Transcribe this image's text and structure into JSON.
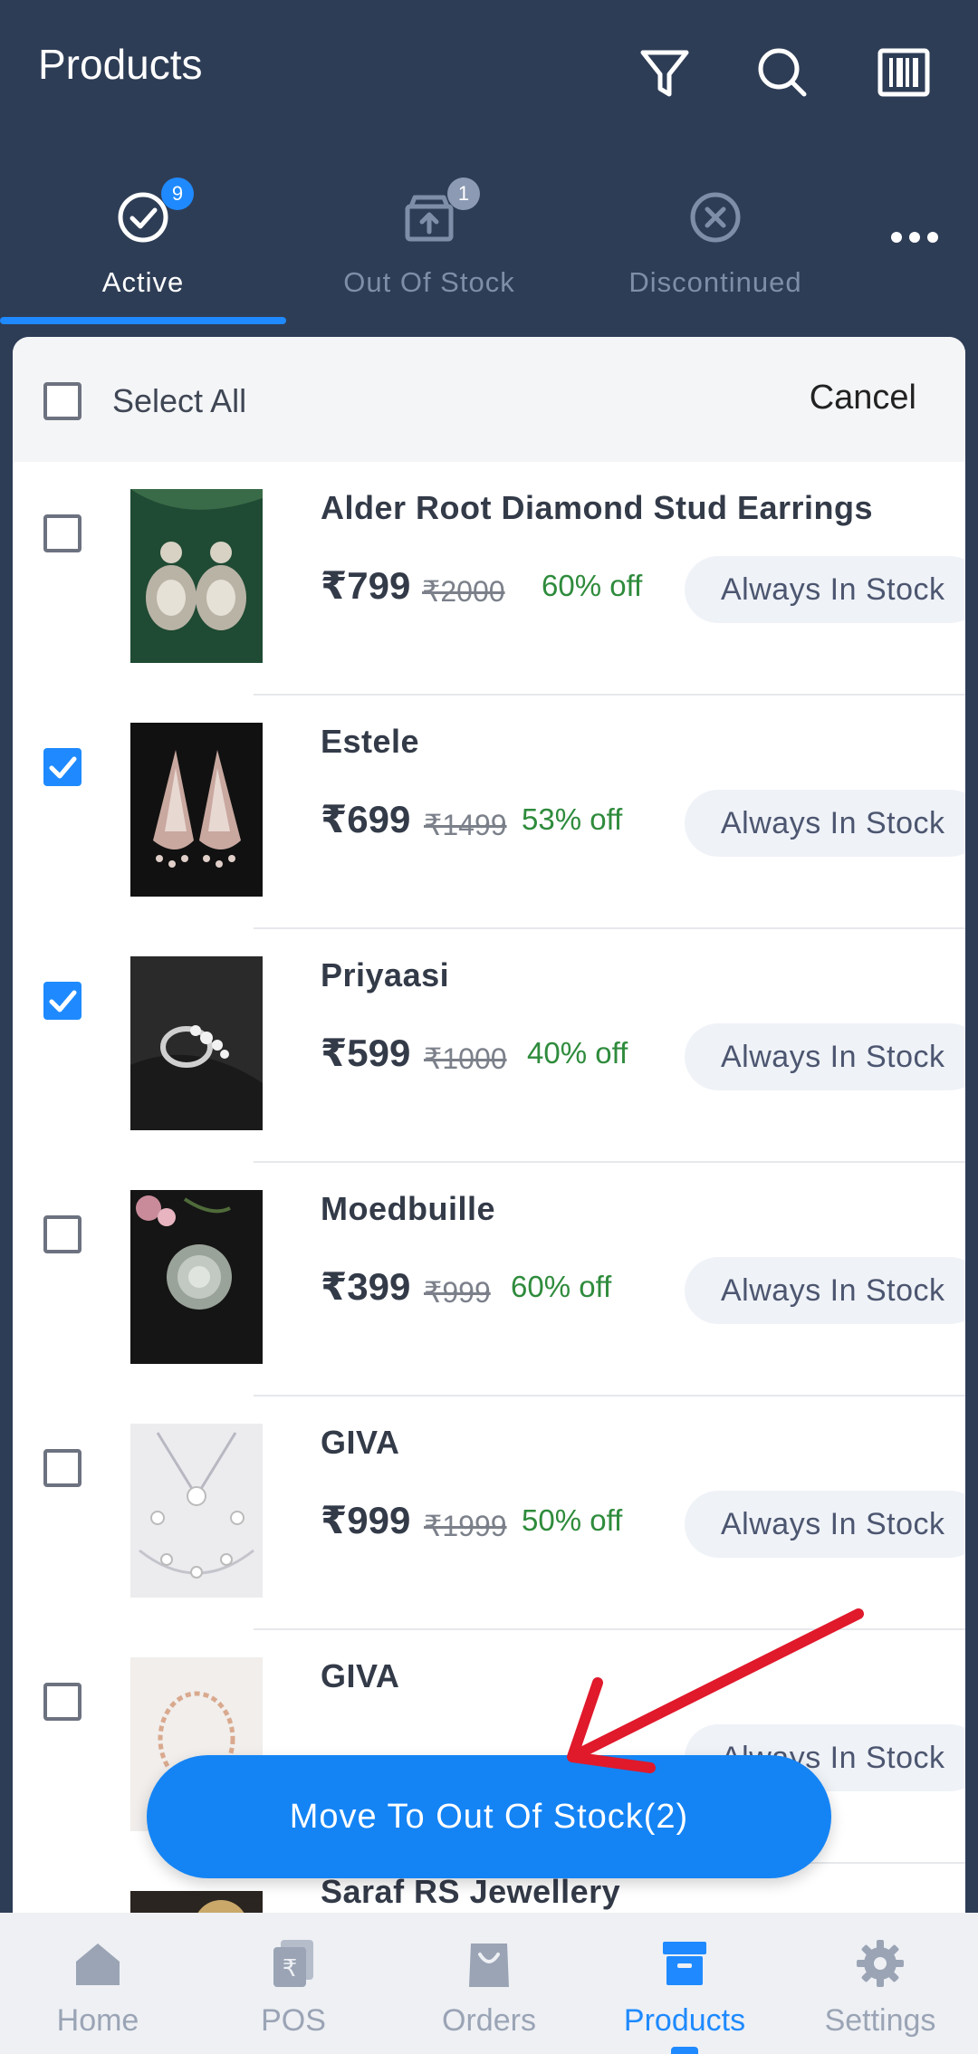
{
  "header": {
    "title": "Products",
    "icons": [
      "filter-icon",
      "search-icon",
      "barcode-icon"
    ]
  },
  "tabs": [
    {
      "label": "Active",
      "badge": "9",
      "icon": "check-circle-icon",
      "active": true
    },
    {
      "label": "Out Of Stock",
      "badge": "1",
      "icon": "box-upload-icon",
      "active": false
    },
    {
      "label": "Discontinued",
      "badge": "",
      "icon": "x-circle-icon",
      "active": false
    }
  ],
  "select_bar": {
    "select_all_label": "Select All",
    "cancel_label": "Cancel"
  },
  "products": [
    {
      "name": "Alder Root Diamond Stud Earrings",
      "price": "₹799",
      "mrp": "₹2000",
      "discount": "60% off",
      "stock": "Always In Stock",
      "checked": false
    },
    {
      "name": "Estele",
      "price": "₹699",
      "mrp": "₹1499",
      "discount": "53% off",
      "stock": "Always In Stock",
      "checked": true
    },
    {
      "name": "Priyaasi",
      "price": "₹599",
      "mrp": "₹1000",
      "discount": "40% off",
      "stock": "Always In Stock",
      "checked": true
    },
    {
      "name": "Moedbuille",
      "price": "₹399",
      "mrp": "₹999",
      "discount": "60% off",
      "stock": "Always In Stock",
      "checked": false
    },
    {
      "name": "GIVA",
      "price": "₹999",
      "mrp": "₹1999",
      "discount": "50% off",
      "stock": "Always In Stock",
      "checked": false
    },
    {
      "name": "GIVA",
      "price": "",
      "mrp": "",
      "discount": "",
      "stock": "Always In Stock",
      "checked": false
    },
    {
      "name": "Saraf RS Jewellery",
      "price": "",
      "mrp": "",
      "discount": "",
      "stock": "",
      "checked": false
    }
  ],
  "action": {
    "move_label": "Move To Out Of Stock(2)"
  },
  "bottom_nav": [
    {
      "label": "Home",
      "icon": "home-icon",
      "active": false
    },
    {
      "label": "POS",
      "icon": "pos-icon",
      "active": false
    },
    {
      "label": "Orders",
      "icon": "orders-bag-icon",
      "active": false
    },
    {
      "label": "Products",
      "icon": "products-box-icon",
      "active": true
    },
    {
      "label": "Settings",
      "icon": "gear-icon",
      "active": false
    }
  ],
  "colors": {
    "header_bg": "#2e3d56",
    "accent": "#1f8aff",
    "discount": "#2e8b3c",
    "annotation_arrow": "#e0192b"
  }
}
